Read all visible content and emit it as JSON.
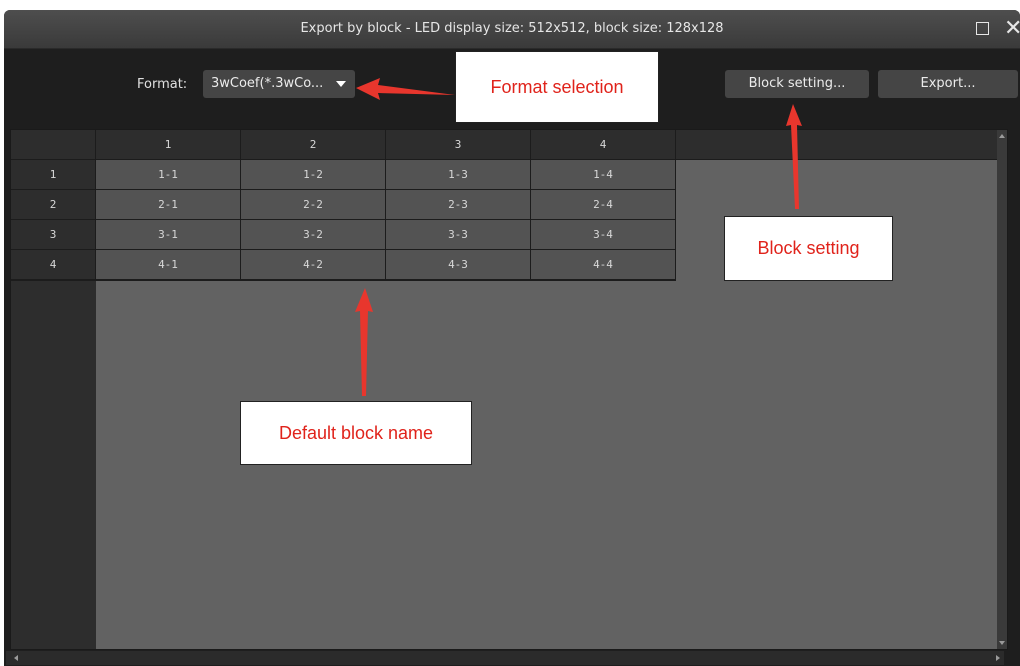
{
  "window": {
    "title": "Export by block - LED display size: 512x512, block size: 128x128",
    "close_glyph": "✕"
  },
  "toolbar": {
    "format_label": "Format:",
    "format_value": "3wCoef(*.3wCo...",
    "block_setting_label": "Block setting...",
    "export_label": "Export..."
  },
  "grid": {
    "column_headers": [
      "1",
      "2",
      "3",
      "4"
    ],
    "row_headers": [
      "1",
      "2",
      "3",
      "4"
    ],
    "cells": [
      [
        "1-1",
        "1-2",
        "1-3",
        "1-4"
      ],
      [
        "2-1",
        "2-2",
        "2-3",
        "2-4"
      ],
      [
        "3-1",
        "3-2",
        "3-3",
        "3-4"
      ],
      [
        "4-1",
        "4-2",
        "4-3",
        "4-4"
      ]
    ]
  },
  "annotations": {
    "format_selection": "Format selection",
    "block_setting": "Block setting",
    "default_block_name": "Default block name",
    "color": "#e0231b"
  },
  "icons": [
    "maximize-icon",
    "close-icon",
    "dropdown-caret-icon",
    "scroll-arrow-icon"
  ]
}
